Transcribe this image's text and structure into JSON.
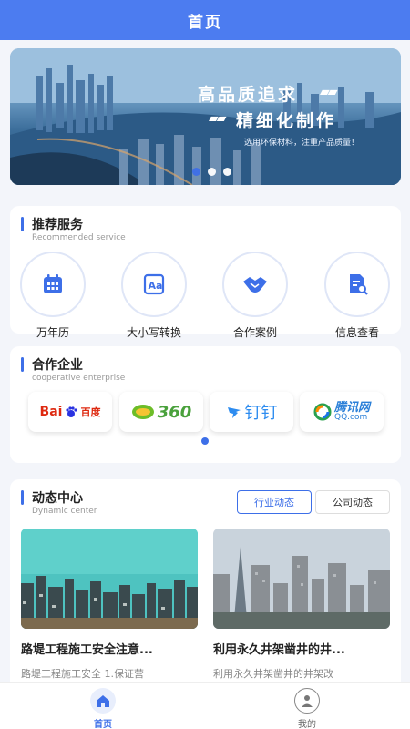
{
  "header": {
    "title": "首页"
  },
  "banner": {
    "headline": "高品质追求",
    "headline2": "精细化制作",
    "subtitle": "选用环保材料，注重产品质量！",
    "slide_count": 3,
    "active_slide": 1
  },
  "services": {
    "title": "推荐服务",
    "subtitle": "Recommended service",
    "items": [
      {
        "label": "万年历",
        "icon": "calendar-icon"
      },
      {
        "label": "大小写转换",
        "icon": "text-case-icon"
      },
      {
        "label": "合作案例",
        "icon": "handshake-icon"
      },
      {
        "label": "信息查看",
        "icon": "document-search-icon"
      }
    ]
  },
  "partners": {
    "title": "合作企业",
    "subtitle": "cooperative enterprise",
    "logos": [
      {
        "name": "Bai",
        "name2": "百度"
      },
      {
        "name": "360"
      },
      {
        "name": "钉钉"
      },
      {
        "name": "腾讯网",
        "name2": "QQ.com"
      }
    ]
  },
  "news": {
    "title": "动态中心",
    "subtitle": "Dynamic center",
    "tabs": [
      {
        "label": "行业动态",
        "active": true
      },
      {
        "label": "公司动态",
        "active": false
      }
    ],
    "articles": [
      {
        "title": "路堤工程施工安全注意...",
        "desc": "路堤工程施工安全 1.保证营"
      },
      {
        "title": "利用永久井架凿井的井...",
        "desc": "利用永久井架凿井的井架改"
      }
    ]
  },
  "tabbar": {
    "items": [
      {
        "label": "首页",
        "icon": "home-icon",
        "active": true
      },
      {
        "label": "我的",
        "icon": "user-icon",
        "active": false
      }
    ]
  },
  "colors": {
    "primary": "#3d6fe8",
    "header": "#4c7cf0",
    "background": "#f3f5fa"
  }
}
